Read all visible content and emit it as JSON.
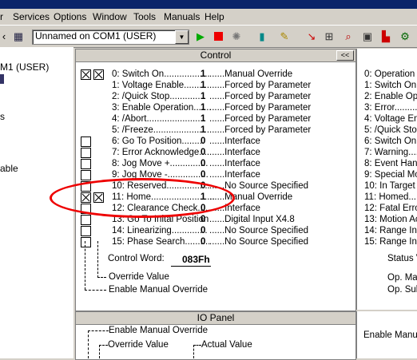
{
  "menu": [
    "r",
    "Services",
    "Options",
    "Window",
    "Tools",
    "Manuals",
    "Help"
  ],
  "toolbar": {
    "combo_value": "Unnamed on COM1 (USER)",
    "icons": [
      "prev-icon",
      "connection-icon",
      "run-icon",
      "stop-icon",
      "reset-icon",
      "panel-icon",
      "wand-icon",
      "probe-icon",
      "network-icon",
      "zoom-icon",
      "device-icon",
      "book-icon",
      "settings-icon"
    ]
  },
  "left": {
    "lines": [
      "M1 (USER)",
      "s",
      "able"
    ]
  },
  "control": {
    "title": "Control",
    "collapse": "<<",
    "rows": [
      {
        "label": "0: Switch On..................",
        "value": "1",
        "source": "......Manual Override",
        "cb1": "x",
        "cb2": "x"
      },
      {
        "label": "1: Voltage Enable..........",
        "value": "1",
        "source": "......Forced by Parameter",
        "cb1": "",
        "cb2": ""
      },
      {
        "label": "2: /Quick Stop..............",
        "value": "1",
        "source": "......Forced by Parameter",
        "cb1": "",
        "cb2": ""
      },
      {
        "label": "3: Enable Operation.......",
        "value": "1",
        "source": "......Forced by Parameter",
        "cb1": "",
        "cb2": ""
      },
      {
        "label": "4: /Abort.......................",
        "value": "1",
        "source": "......Forced by Parameter",
        "cb1": "",
        "cb2": ""
      },
      {
        "label": "5: /Freeze......................",
        "value": "1",
        "source": "......Forced by Parameter",
        "cb1": "",
        "cb2": ""
      },
      {
        "label": "6: Go To Position.........",
        "value": "0",
        "source": "......Interface",
        "cb1": "box",
        "cb2": ""
      },
      {
        "label": "7: Error Acknowledge....",
        "value": "0",
        "source": "......Interface",
        "cb1": "box",
        "cb2": ""
      },
      {
        "label": "8: Jog Move +...............",
        "value": "0",
        "source": "......Interface",
        "cb1": "box",
        "cb2": ""
      },
      {
        "label": "9: Jog Move -................",
        "value": "0",
        "source": "......Interface",
        "cb1": "box",
        "cb2": ""
      },
      {
        "label": "10: Reserved.................",
        "value": "0",
        "source": "......No Source Specified",
        "cb1": "box",
        "cb2": ""
      },
      {
        "label": "11: Home.........................",
        "value": "1",
        "source": "......Manual Override",
        "cb1": "x",
        "cb2": "x"
      },
      {
        "label": "12: Clearance Check.....",
        "value": "0",
        "source": "......Interface",
        "cb1": "box",
        "cb2": ""
      },
      {
        "label": "13: Go To Inital Position",
        "value": "0",
        "source": "......Digital Input X4.8",
        "cb1": "box",
        "cb2": ""
      },
      {
        "label": "14: Linearizing..............",
        "value": "0",
        "source": "......No Source Specified",
        "cb1": "box",
        "cb2": ""
      },
      {
        "label": "15: Phase Search..........",
        "value": "0",
        "source": "......No Source Specified",
        "cb1": "box",
        "cb2": ""
      }
    ],
    "control_word_label": "Control Word:",
    "control_word_value": "083Fh",
    "override_value_label": "Override Value",
    "enable_manual_override_label": "Enable Manual Override"
  },
  "right": {
    "rows": [
      "0: Operation E",
      "1: Switch On.",
      "2: Enable Ope",
      "3: Error..........",
      "4: Voltage En",
      "5: /Quick Sto",
      "6: Switch On",
      "7: Warning.....",
      "8: Event Hand",
      "9: Special Mo",
      "10: In Target",
      "11: Homed.....",
      "12: Fatal Erro",
      "13: Motion Ac",
      "14: Range Ind",
      "15: Range Ind"
    ],
    "status": "Status V",
    "op1": "Op. Mai",
    "op2": "Op. Sub",
    "enable_manual": "Enable Manua"
  },
  "io": {
    "title": "IO Panel",
    "enable_manual_override": "Enable Manual Override",
    "override_value": "Override Value",
    "actual_value": "Actual Value"
  },
  "colors": {
    "highlight_ellipse": "#e00000",
    "title_bar": "#0a246a"
  }
}
